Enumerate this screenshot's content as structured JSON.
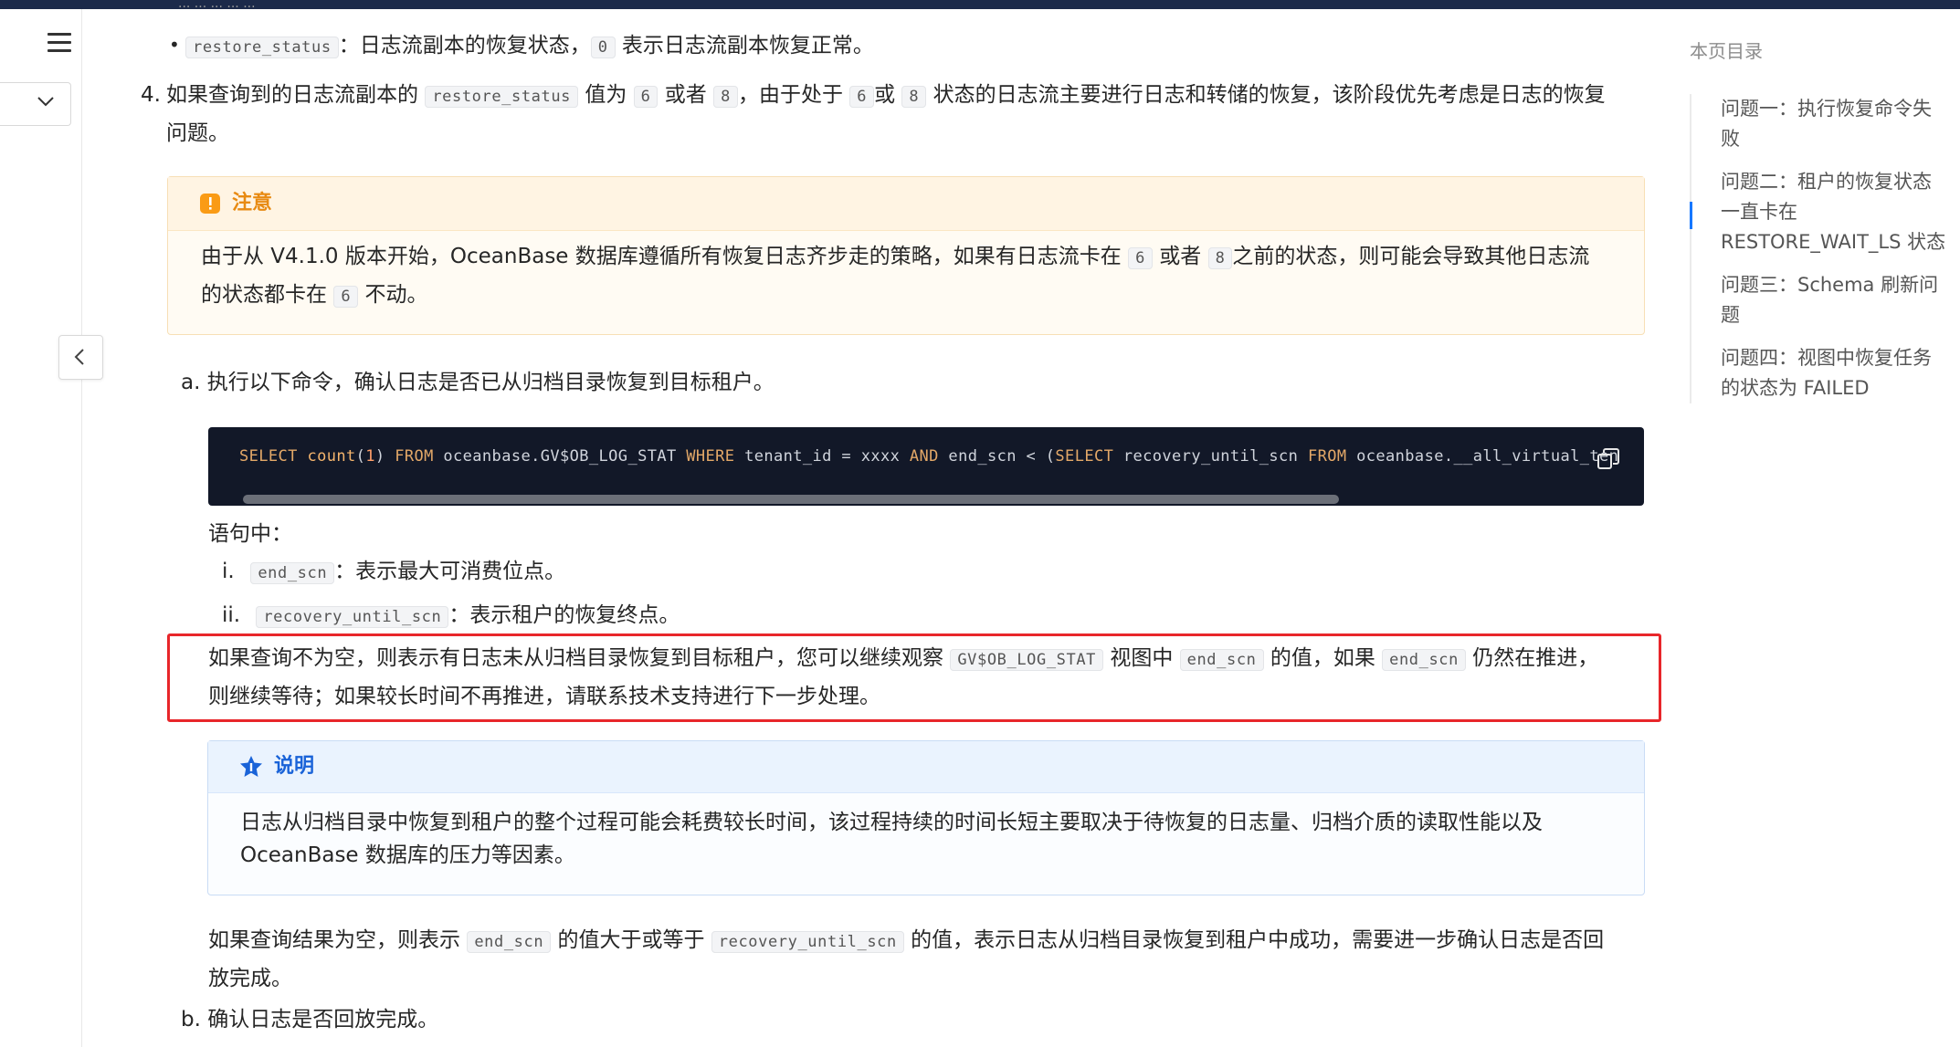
{
  "top_partial": "... ... ... ... ...",
  "sidebar": {
    "menu_icon": "menu-icon",
    "collapse_icon": "chevron-left-icon",
    "dropdown_icon": "chevron-down-icon"
  },
  "content": {
    "bullet_restore": {
      "code": "restore_status",
      "text_a": "：日志流副本的恢复状态，",
      "code2": "0",
      "text_b": "表示日志流副本恢复正常。"
    },
    "step4": {
      "num": "4.",
      "t1": "如果查询到的日志流副本的",
      "code1": "restore_status",
      "t2": "值为",
      "c6": "6",
      "t3": "或者",
      "c8": "8",
      "t4": "，由于处于",
      "c6b": "6",
      "t5": "或",
      "c8b": "8",
      "t6": "状态的日志流主要进行日志和转储的恢复，该阶段优先考虑是日志的恢复",
      "t7": "问题。"
    },
    "warn": {
      "title": "注意",
      "l1a": "由于从 V4.1.0 版本开始，OceanBase 数据库遵循所有恢复日志齐步走的策略，如果有日志流卡在",
      "c6": "6",
      "l1b": "或者",
      "c8": "8",
      "l1c": "之前的状态，则可能会导致其他日志流",
      "l2a": "的状态都卡在",
      "c6b": "6",
      "l2b": "不动。"
    },
    "sub_a": {
      "label": "a.",
      "text": "执行以下命令，确认日志是否已从归档目录恢复到目标租户。"
    },
    "sql": {
      "p1": "SELECT ",
      "p2": "count",
      "p3": "(",
      "p4": "1",
      "p5": ") ",
      "p6": "FROM",
      "p7": " oceanbase.GV$OB_LOG_STAT ",
      "p8": "WHERE",
      "p9": " tenant_id = xxxx ",
      "p10": "AND",
      "p11": " end_scn < (",
      "p12": "SELECT",
      "p13": " recovery_until_scn ",
      "p14": "FROM",
      "p15": " oceanbase.__all_virtual_ten"
    },
    "stmt_label": "语句中：",
    "item_i": {
      "num": "i.",
      "code": "end_scn",
      "text": "：表示最大可消费位点。"
    },
    "item_ii": {
      "num": "ii.",
      "code": "recovery_until_scn",
      "text": "：表示租户的恢复终点。"
    },
    "highlight": {
      "t1": "如果查询不为空，则表示有日志未从归档目录恢复到目标租户，您可以继续观察",
      "c1": "GV$OB_LOG_STAT",
      "t2": "视图中",
      "c2": "end_scn",
      "t3": "的值，如果",
      "c3": "end_scn",
      "t4": "仍然在推进，",
      "t5": "则继续等待；如果较长时间不再推进，请联系技术支持进行下一步处理。"
    },
    "note": {
      "title": "说明",
      "l1": "日志从归档目录中恢复到租户的整个过程可能会耗费较长时间，该过程持续的时间长短主要取决于待恢复的日志量、归档介质的读取性能以及",
      "l2": "OceanBase 数据库的压力等因素。"
    },
    "empty_result": {
      "t1": "如果查询结果为空，则表示",
      "c1": "end_scn",
      "t2": "的值大于或等于",
      "c2": "recovery_until_scn",
      "t3": "的值，表示日志从归档目录恢复到租户中成功，需要进一步确认日志是否回",
      "t4": "放完成。"
    },
    "sub_b": {
      "label": "b.",
      "text": "确认日志是否回放完成。"
    }
  },
  "toc": {
    "title": "本页目录",
    "items": [
      {
        "l1": "问题一：执行恢复命令失",
        "l2": "败"
      },
      {
        "l1": "问题二：租户的恢复状态",
        "l2": "一直卡在",
        "l3": "RESTORE_WAIT_LS 状态"
      },
      {
        "l1": "问题三：Schema 刷新问",
        "l2": "题"
      },
      {
        "l1": "问题四：视图中恢复任务",
        "l2": "的状态为 FAILED"
      }
    ]
  },
  "colors": {
    "accent": "#1677ff",
    "warn": "#fa8c16",
    "highlight_border": "#e8262a",
    "code_bg": "#121828"
  }
}
